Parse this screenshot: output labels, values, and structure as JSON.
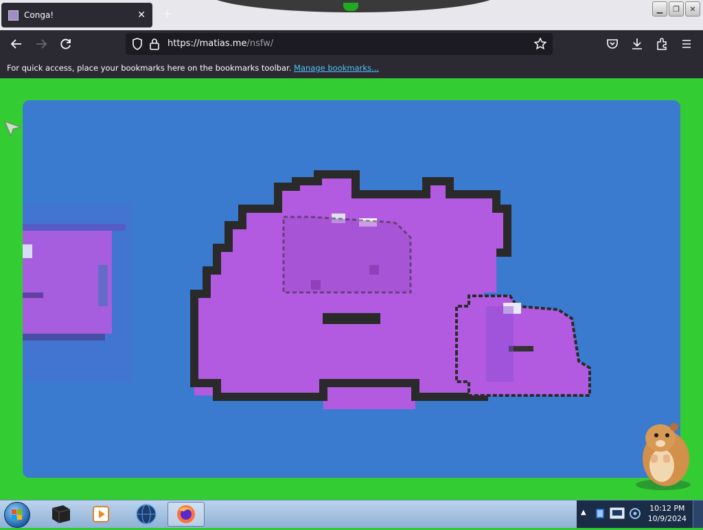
{
  "browser": {
    "tab": {
      "title": "Conga!",
      "close_icon": "close-icon"
    },
    "newtab_icon": "plus-icon",
    "window_buttons": [
      "minimize",
      "restore",
      "close"
    ],
    "nav": {
      "back_icon": "back-arrow-icon",
      "forward_icon": "forward-arrow-icon",
      "reload_icon": "reload-icon",
      "url": "https://matias.me/nsfw/",
      "url_host": "https://matias.me",
      "url_path": "/nsfw/",
      "toolbar_icons": [
        "pocket-icon",
        "download-icon",
        "extensions-icon",
        "menu-icon"
      ]
    },
    "bookmarks_bar": {
      "message": "For quick access, place your bookmarks here on the bookmarks toolbar.",
      "link": "Manage bookmarks..."
    }
  },
  "page": {
    "background_color": "#33cc33",
    "stage_color": "#3a7bd0",
    "sprite_color": "#b25be0",
    "sprite_outline": "#2a2a2a"
  },
  "taskbar": {
    "items": [
      "start-orb",
      "terminal-app",
      "media-player-app",
      "globe-app",
      "firefox-app"
    ],
    "active_item": "firefox-app",
    "time": "10:12 PM",
    "date": "10/9/2024"
  }
}
